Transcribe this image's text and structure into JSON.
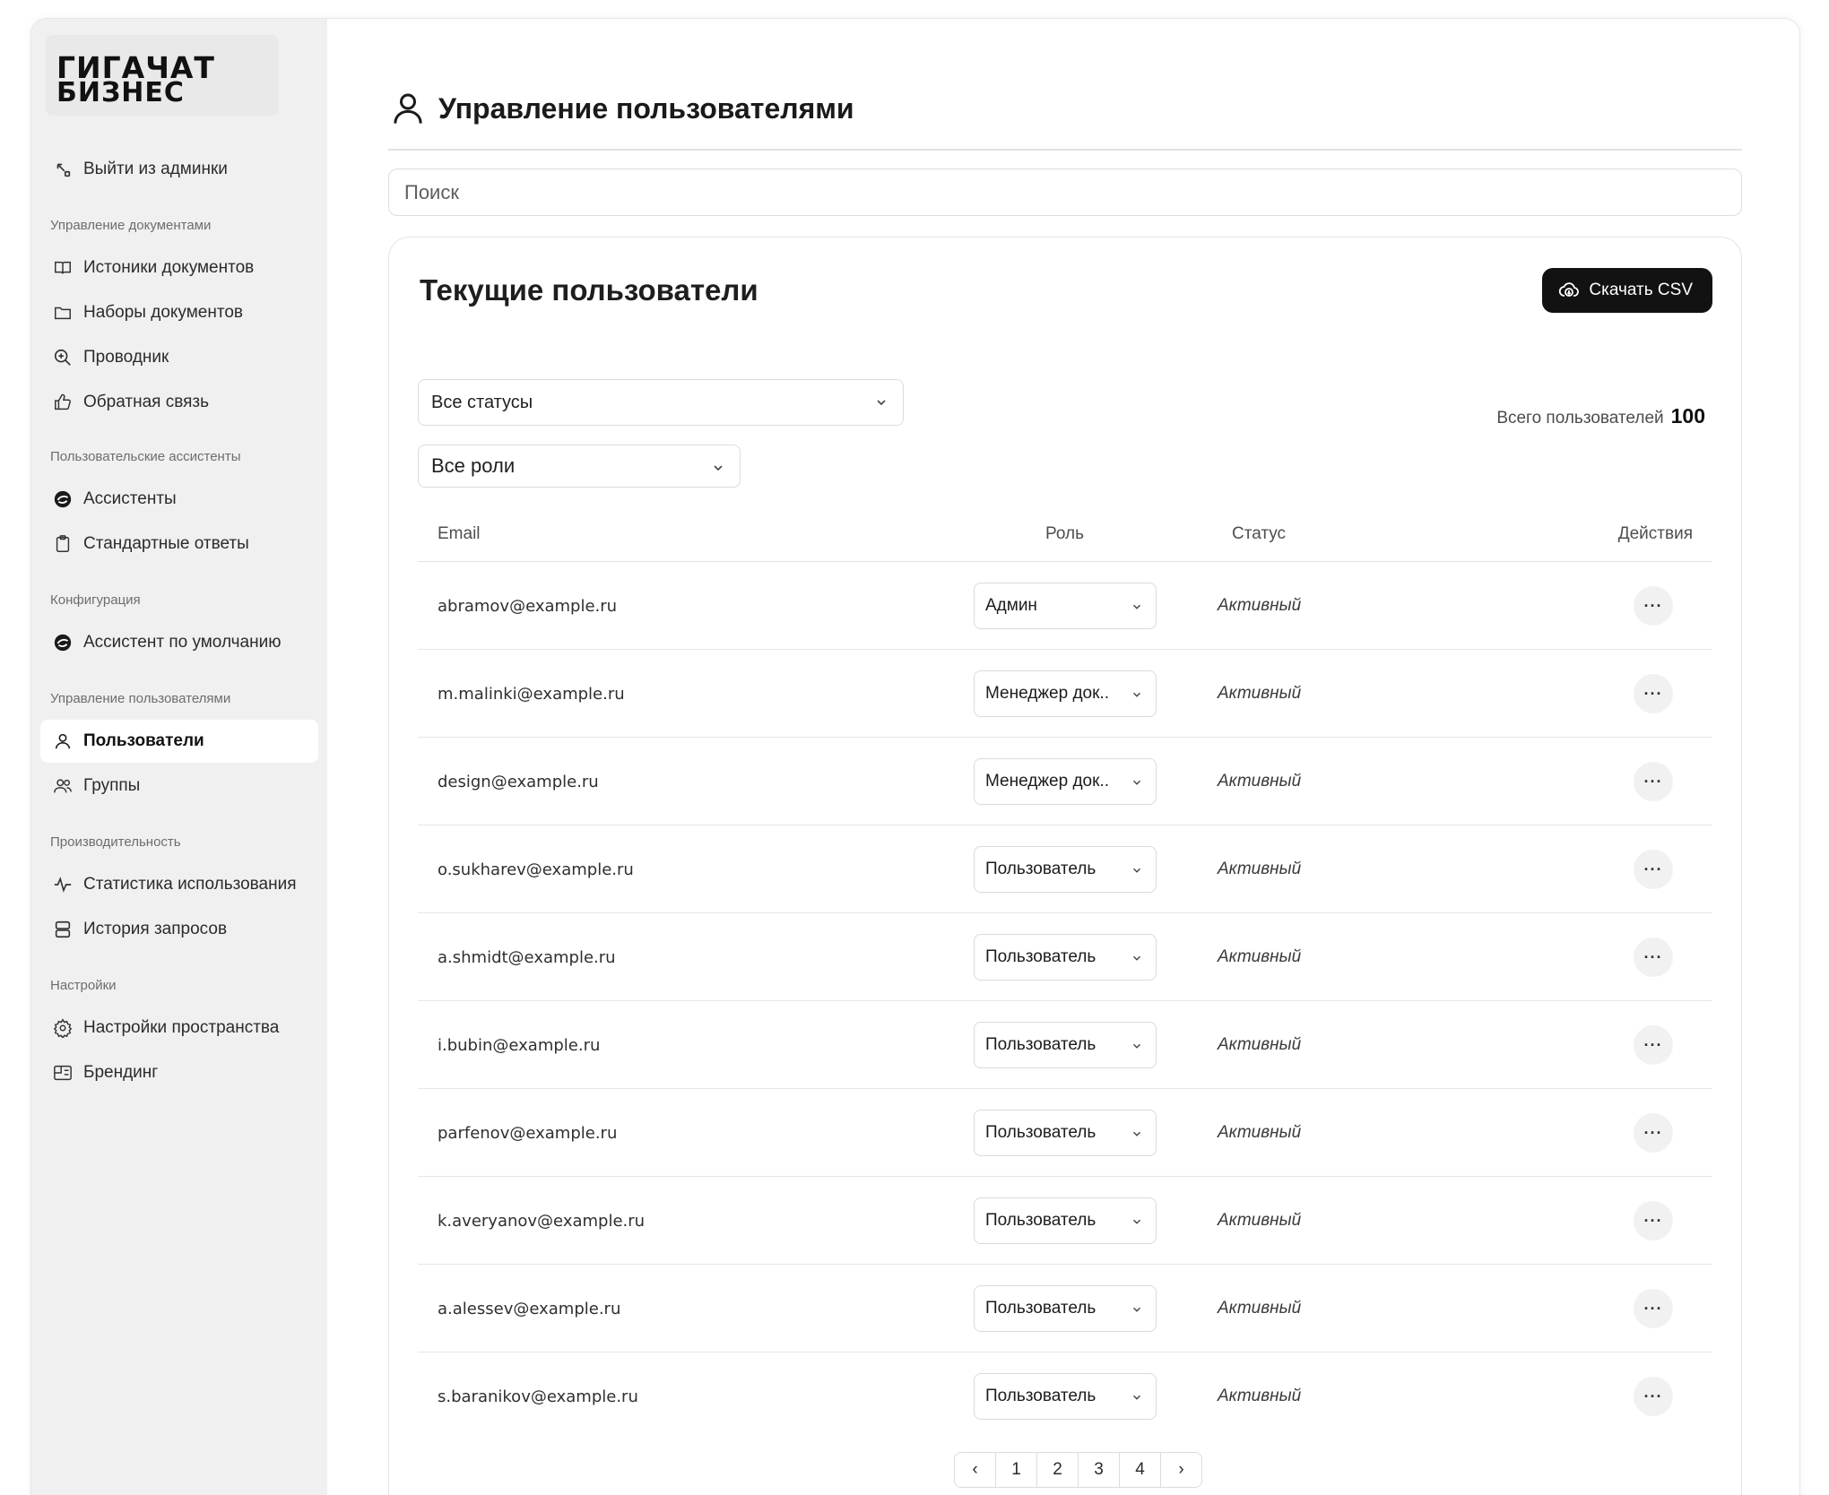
{
  "brand": {
    "line1": "ГИГАЧАТ",
    "line2": "БИЗНЕС"
  },
  "sidebar": {
    "exit": {
      "label": "Выйти из админки",
      "icon": "exit-arrow-icon"
    },
    "sections": [
      {
        "title": "Управление документами",
        "items": [
          {
            "label": "Истоники документов",
            "icon": "book-icon"
          },
          {
            "label": "Наборы документов",
            "icon": "folder-icon"
          },
          {
            "label": "Проводник",
            "icon": "zoom-in-icon"
          },
          {
            "label": "Обратная связь",
            "icon": "thumb-up-icon"
          }
        ]
      },
      {
        "title": "Пользовательские ассистенты",
        "items": [
          {
            "label": "Ассистенты",
            "icon": "assistant-icon"
          },
          {
            "label": "Стандартные ответы",
            "icon": "clipboard-icon"
          }
        ]
      },
      {
        "title": "Конфигурация",
        "items": [
          {
            "label": "Ассистент по умолчанию",
            "icon": "assistant-icon"
          }
        ]
      },
      {
        "title": "Управление пользователями",
        "items": [
          {
            "label": "Пользователи",
            "icon": "user-icon",
            "active": true
          },
          {
            "label": "Группы",
            "icon": "users-icon"
          }
        ]
      },
      {
        "title": "Производительность",
        "items": [
          {
            "label": "Статистика использования",
            "icon": "activity-icon"
          },
          {
            "label": "История запросов",
            "icon": "server-icon"
          }
        ]
      },
      {
        "title": "Настройки",
        "items": [
          {
            "label": "Настройки пространства",
            "icon": "gear-icon"
          },
          {
            "label": "Брендинг",
            "icon": "branding-icon"
          }
        ]
      }
    ]
  },
  "page": {
    "title": "Управление пользователями",
    "search_placeholder": "Поиск"
  },
  "card": {
    "title": "Текущие пользователи",
    "csv_button": "Скачать CSV",
    "status_filter": "Все статусы",
    "role_filter": "Все роли",
    "total_label": "Всего пользователей",
    "total_value": "100"
  },
  "table": {
    "columns": {
      "email": "Email",
      "role": "Роль",
      "status": "Статус",
      "actions": "Действия"
    },
    "rows": [
      {
        "email": "abramov@example.ru",
        "role": "Админ",
        "status": "Активный"
      },
      {
        "email": "m.malinki@example.ru",
        "role": "Менеджер док..",
        "status": "Активный"
      },
      {
        "email": "design@example.ru",
        "role": "Менеджер док..",
        "status": "Активный"
      },
      {
        "email": "o.sukharev@example.ru",
        "role": "Пользователь",
        "status": "Активный"
      },
      {
        "email": "a.shmidt@example.ru",
        "role": "Пользователь",
        "status": "Активный"
      },
      {
        "email": "i.bubin@example.ru",
        "role": "Пользователь",
        "status": "Активный"
      },
      {
        "email": "parfenov@example.ru",
        "role": "Пользователь",
        "status": "Активный"
      },
      {
        "email": "k.averyanov@example.ru",
        "role": "Пользователь",
        "status": "Активный"
      },
      {
        "email": "a.alessev@example.ru",
        "role": "Пользователь",
        "status": "Активный"
      },
      {
        "email": "s.baranikov@example.ru",
        "role": "Пользователь",
        "status": "Активный"
      }
    ],
    "actions_glyph": "···"
  },
  "pagination": {
    "prev": "‹",
    "pages": [
      "1",
      "2",
      "3",
      "4"
    ],
    "next": "›"
  }
}
